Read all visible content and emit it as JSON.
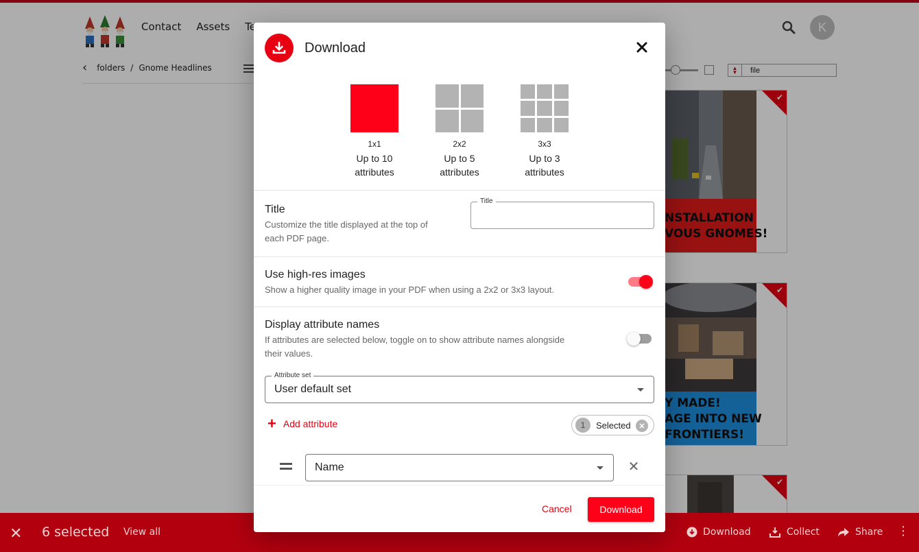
{
  "header": {
    "nav": [
      "Contact",
      "Assets",
      "Te"
    ],
    "avatar_initial": "K"
  },
  "breadcrumb": {
    "items": [
      "folders",
      "Gnome Headlines"
    ],
    "separator": "/"
  },
  "sort": {
    "value": "file"
  },
  "cards": [
    {
      "banner_lines": [
        "NSTALLATION",
        "VOUS GNOMES!"
      ],
      "banner_color": "#e01b1b"
    },
    {
      "banner_lines": [
        "Y MADE!",
        "AGE INTO NEW",
        "FRONTIERS!"
      ],
      "banner_color": "#1e8fe0"
    }
  ],
  "bottom_bar": {
    "count_label": "6 selected",
    "view_all": "View all",
    "actions": {
      "download": "Download",
      "collect": "Collect",
      "share": "Share"
    }
  },
  "dialog": {
    "title": "Download",
    "layouts": [
      {
        "label": "1x1",
        "line1": "Up to 10",
        "line2": "attributes",
        "grid": 1,
        "selected": true
      },
      {
        "label": "2x2",
        "line1": "Up to 5",
        "line2": "attributes",
        "grid": 2,
        "selected": false
      },
      {
        "label": "3x3",
        "line1": "Up to 3",
        "line2": "attributes",
        "grid": 3,
        "selected": false
      }
    ],
    "title_section": {
      "heading": "Title",
      "desc1": "Customize the title displayed at the top of",
      "desc2": "each PDF page.",
      "field_label": "Title",
      "value": ""
    },
    "hires": {
      "heading": "Use high-res images",
      "desc": "Show a higher quality image in your PDF when using a 2x2 or 3x3 layout.",
      "on": true
    },
    "attr_names": {
      "heading": "Display attribute names",
      "desc1": "If attributes are selected below, toggle on to show attribute names alongside",
      "desc2": "their values.",
      "on": false
    },
    "attribute_set": {
      "label": "Attribute set",
      "value": "User default set"
    },
    "add_attribute": "Add attribute",
    "selected_chip": {
      "count": "1",
      "label": "Selected"
    },
    "attribute_row": {
      "value": "Name"
    },
    "cancel": "Cancel",
    "download": "Download"
  },
  "colors": {
    "accent": "#ff0019",
    "bottom_bar": "#b3000f",
    "grey_tile": "#b3b3b3"
  }
}
